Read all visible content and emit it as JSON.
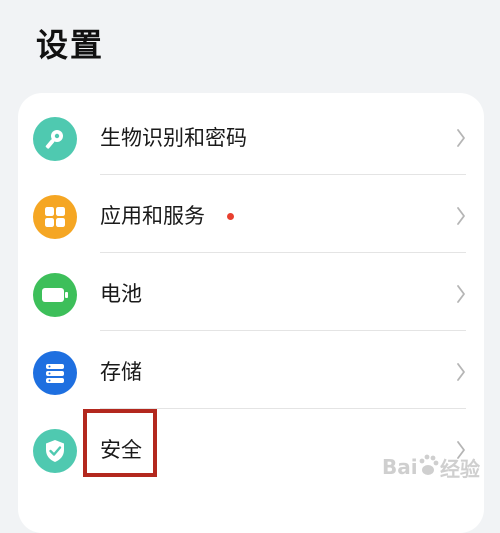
{
  "header": {
    "title": "设置"
  },
  "settings": {
    "items": [
      {
        "label": "生物识别和密码",
        "icon": "key-icon",
        "color": "#4fc9b0"
      },
      {
        "label": "应用和服务",
        "icon": "apps-grid-icon",
        "color": "#f5a623",
        "badge": "red-dot"
      },
      {
        "label": "电池",
        "icon": "battery-icon",
        "color": "#3dbf5a"
      },
      {
        "label": "存储",
        "icon": "storage-icon",
        "color": "#1e6fe0"
      },
      {
        "label": "安全",
        "icon": "shield-check-icon",
        "color": "#4fc9b0"
      }
    ]
  },
  "colors": {
    "background": "#f1f3f5",
    "card": "#ffffff",
    "highlight": "#b3281e",
    "badge": "#e8402f"
  },
  "watermark": {
    "text": "Bai经验",
    "logo": "paw-logo"
  }
}
